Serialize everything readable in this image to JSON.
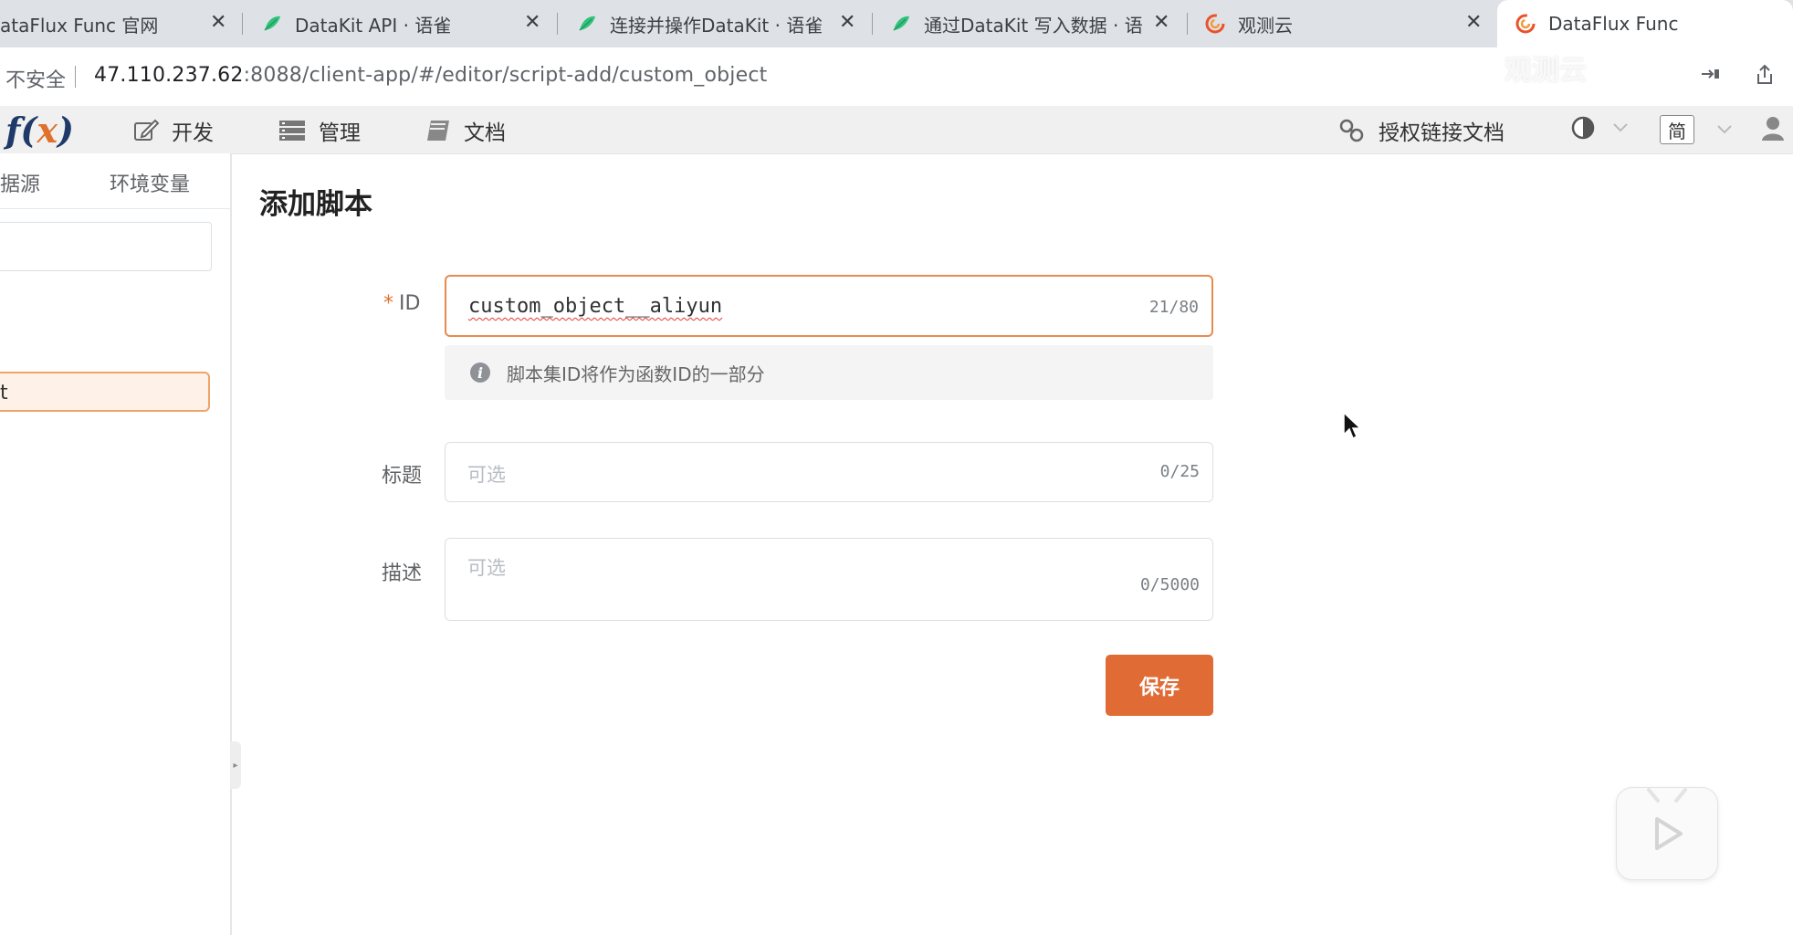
{
  "browser": {
    "tabs": [
      {
        "title": "ataFlux Func 官网",
        "icon": "dataflux-icon",
        "active": false
      },
      {
        "title": "DataKit API · 语雀",
        "icon": "yuque-icon",
        "active": false
      },
      {
        "title": "连接并操作DataKit · 语雀",
        "icon": "yuque-icon",
        "active": false
      },
      {
        "title": "通过DataKit 写入数据 · 语",
        "icon": "yuque-icon",
        "active": false
      },
      {
        "title": "观测云",
        "icon": "guance-icon",
        "active": false
      },
      {
        "title": "DataFlux Func",
        "icon": "guance-icon",
        "active": true
      }
    ],
    "close_glyph": "✕",
    "security_label": "不安全",
    "url_host": "47.110.237.62",
    "url_path": ":8088/client-app/#/editor/script-add/custom_object",
    "watermark": "观测云"
  },
  "navbar": {
    "logo_f": "f",
    "logo_open": "(",
    "logo_x": "x",
    "logo_close": ")",
    "items": [
      {
        "label": "开发",
        "icon": "edit-icon"
      },
      {
        "label": "管理",
        "icon": "server-icon"
      },
      {
        "label": "文档",
        "icon": "book-icon"
      }
    ],
    "auth_link_label": "授权链接文档",
    "theme_icon": "theme-half-circle-icon",
    "language_label": "简",
    "user_icon": "user-icon"
  },
  "sidebar": {
    "tabs": [
      "据源",
      "环境变量"
    ],
    "selected_item_label": "t"
  },
  "form": {
    "page_title": "添加脚本",
    "id_label": "ID",
    "id_value": "custom_object__aliyun",
    "id_count": "21/80",
    "id_hint": "脚本集ID将作为函数ID的一部分",
    "title_label": "标题",
    "title_placeholder": "可选",
    "title_count": "0/25",
    "desc_label": "描述",
    "desc_placeholder": "可选",
    "desc_count": "0/5000",
    "save_label": "保存"
  },
  "colors": {
    "accent": "#e06b35",
    "logo_blue": "#1f3a68",
    "logo_orange": "#e0712c"
  }
}
